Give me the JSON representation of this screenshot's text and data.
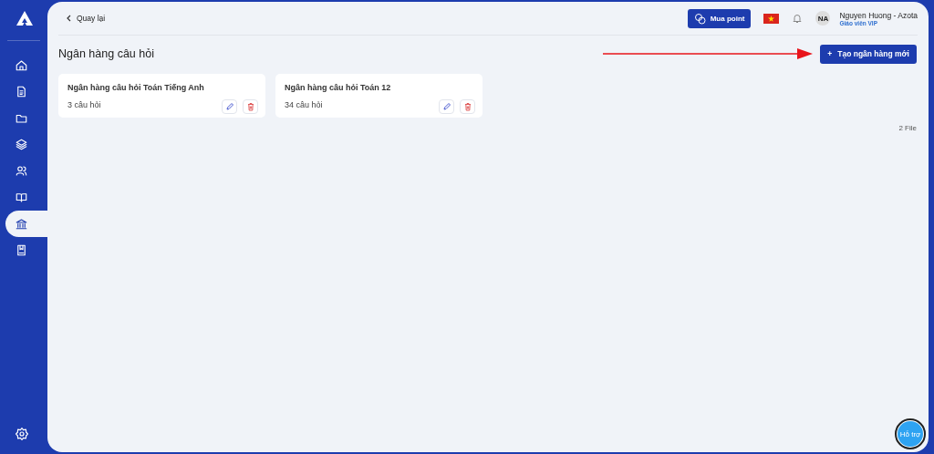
{
  "sidebar": {
    "items": [
      {
        "selected": false
      },
      {
        "selected": false
      },
      {
        "selected": false
      },
      {
        "selected": false
      },
      {
        "selected": false
      },
      {
        "selected": false
      },
      {
        "selected": true
      },
      {
        "selected": false
      }
    ]
  },
  "header": {
    "back": "Quay lại",
    "buy_button": "Mua point",
    "user": {
      "initials": "NA",
      "name": "Nguyen Huong - Azota",
      "role": "Giáo viên VIP"
    }
  },
  "page": {
    "title": "Ngân hàng câu hỏi",
    "create_button": {
      "icon": "+",
      "label": "Tạo ngân hàng mới"
    }
  },
  "banks": [
    {
      "name": "Ngân hàng câu hỏi Toán Tiếng Anh",
      "count": "3 câu hỏi"
    },
    {
      "name": "Ngân hàng câu hỏi Toán 12",
      "count": "34 câu hỏi"
    }
  ],
  "file_count": "2 File",
  "support": {
    "label": "Hỗ trợ"
  }
}
